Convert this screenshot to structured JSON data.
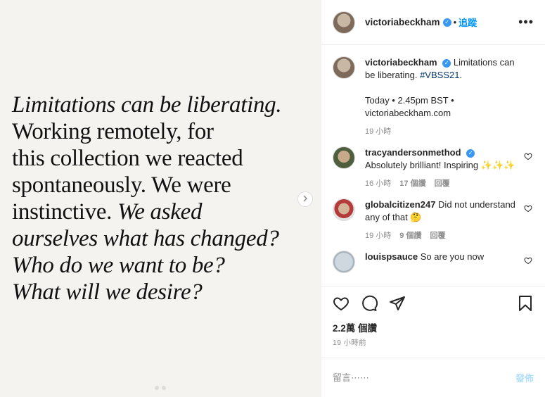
{
  "post": {
    "image_quote": {
      "line1_italic": "Limitations can be liberating.",
      "line2": "Working remotely, for",
      "line3": "this collection we reacted",
      "line4": "spontaneously. We were",
      "line5_normal": "instinctive.",
      "line5_italic": "We asked",
      "line6_italic": "ourselves what has changed?",
      "line7_italic": "Who do we want to be?",
      "line8_italic": "What will we desire?"
    },
    "next_icon": "chevron-right-icon"
  },
  "header": {
    "username": "victoriabeckham",
    "separator": "•",
    "follow_label": "追蹤",
    "more_label": "•••"
  },
  "caption": {
    "username": "victoriabeckham",
    "text": "Limitations can be liberating.",
    "hashtag": "#VBSS21",
    "tail": ".",
    "line2": "Today • 2.45pm BST •",
    "line3": "victoriabeckham.com",
    "time": "19 小時"
  },
  "comments": [
    {
      "username": "tracyandersonmethod",
      "verified": true,
      "text": "Absolutely brilliant! Inspiring",
      "emoji": "✨✨✨",
      "time": "16 小時",
      "likes": "17 個讚",
      "reply": "回覆"
    },
    {
      "username": "globalcitizen247",
      "verified": false,
      "text": "Did not understand any of that",
      "emoji": "🤔",
      "time": "19 小時",
      "likes": "9 個讚",
      "reply": "回覆"
    },
    {
      "username": "louispsauce",
      "verified": false,
      "text": "So are you now",
      "emoji": "",
      "time": "",
      "likes": "",
      "reply": ""
    }
  ],
  "stats": {
    "views": "2.2萬 個讚",
    "posted": "19 小時前"
  },
  "add_comment": {
    "placeholder": "留言⋯⋯",
    "post_label": "發佈"
  },
  "colors": {
    "accent": "#0095f6",
    "verified": "#3897f0",
    "muted": "#8e8e8e",
    "post_disabled": "#b2dffc",
    "image_bg": "#f4f3ef"
  }
}
